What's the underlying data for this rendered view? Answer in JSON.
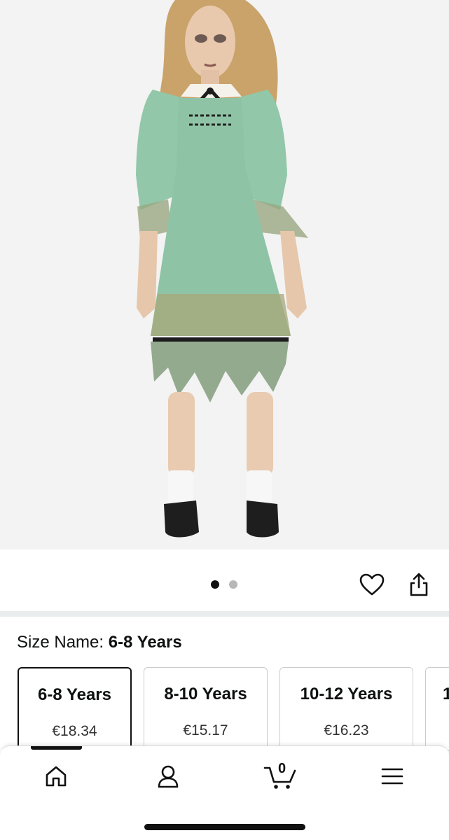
{
  "product": {
    "image_alt": "child wearing green vintage dress costume",
    "carousel": {
      "total": 2,
      "active_index": 0
    }
  },
  "actions": {
    "wishlist_icon": "heart-icon",
    "share_icon": "share-icon"
  },
  "size": {
    "label_prefix": "Size Name: ",
    "selected_value": "6-8 Years",
    "options": [
      {
        "name": "6-8 Years",
        "price": "€18.34",
        "selected": true
      },
      {
        "name": "8-10 Years",
        "price": "€15.17",
        "selected": false
      },
      {
        "name": "10-12 Years",
        "price": "€16.23",
        "selected": false
      },
      {
        "name": "1",
        "price": "",
        "selected": false
      }
    ]
  },
  "bottom_nav": {
    "items": [
      {
        "icon": "home-icon",
        "active": true
      },
      {
        "icon": "account-icon",
        "active": false
      },
      {
        "icon": "cart-icon",
        "active": false
      },
      {
        "icon": "menu-icon",
        "active": false
      }
    ],
    "cart_count": "0"
  },
  "colors": {
    "accent": "#111111",
    "dress": "#8fc3a5",
    "card_border": "#c9cccc"
  }
}
